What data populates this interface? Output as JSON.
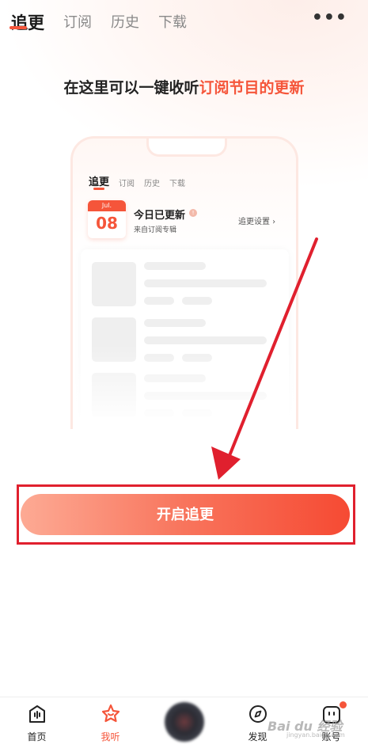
{
  "tabs": [
    {
      "label": "追更",
      "active": true
    },
    {
      "label": "订阅",
      "active": false
    },
    {
      "label": "历史",
      "active": false
    },
    {
      "label": "下载",
      "active": false
    }
  ],
  "more_icon": "more-dots-icon",
  "headline": {
    "prefix": "在这里可以一键收听",
    "highlight": "订阅节目的更新"
  },
  "preview": {
    "tabs": [
      "追更",
      "订阅",
      "历史",
      "下载"
    ],
    "calendar_month": "Jul.",
    "calendar_day": "08",
    "today_title": "今日已更新",
    "info_icon": "!",
    "subtitle": "来自订阅专辑",
    "settings_link": "追更设置 ›"
  },
  "cta_label": "开启追更",
  "bottom_nav": [
    {
      "label": "首页",
      "icon": "home-icon",
      "active": false
    },
    {
      "label": "我听",
      "icon": "star-icon",
      "active": true
    },
    {
      "label": "",
      "icon": "player-disc-icon",
      "active": false
    },
    {
      "label": "发现",
      "icon": "discover-icon",
      "active": false
    },
    {
      "label": "账号",
      "icon": "account-icon",
      "active": false
    }
  ],
  "watermark": {
    "text": "Bai du 经验",
    "sub": "jingyan.baidu.com"
  },
  "colors": {
    "accent": "#f5553a",
    "annotation": "#e0202e"
  }
}
